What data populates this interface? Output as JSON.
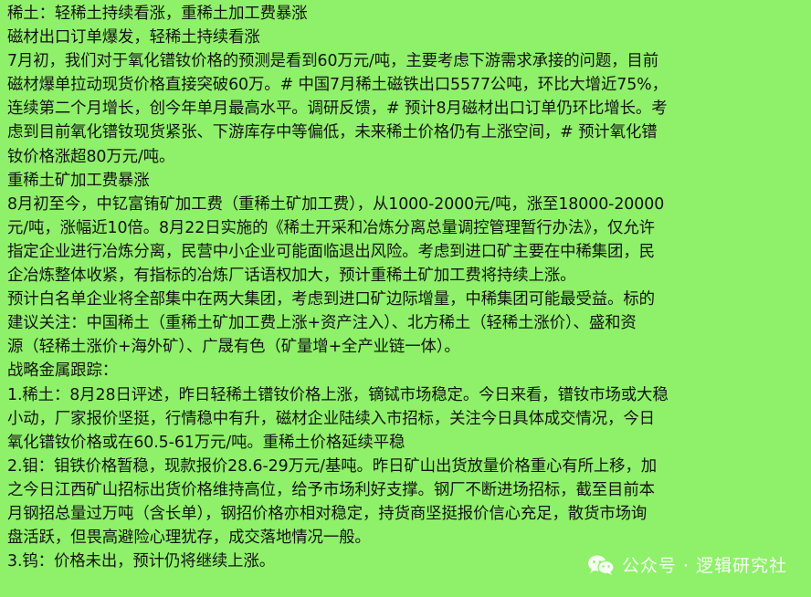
{
  "lines": [
    "稀土：轻稀土持续看涨，重稀土加工费暴涨",
    "磁材出口订单爆发，轻稀土持续看涨",
    "7月初，我们对于氧化镨钕价格的预测是看到60万元/吨，主要考虑下游需求承接的问题，目前",
    "磁材爆单拉动现货价格直接突破60万。# 中国7月稀土磁铁出口5577公吨，环比大增近75%，",
    "连续第二个月增长，创今年单月最高水平。调研反馈，# 预计8月磁材出口订单仍环比增长。考",
    "虑到目前氧化镨钕现货紧张、下游库存中等偏低，未来稀土价格仍有上涨空间，# 预计氧化镨",
    "钕价格涨超80万元/吨。",
    "重稀土矿加工费暴涨",
    "8月初至今，中钇富铕矿加工费（重稀土矿加工费），从1000-2000元/吨，涨至18000-20000",
    "元/吨，涨幅近10倍。8月22日实施的《稀土开采和冶炼分离总量调控管理暂行办法》，仅允许",
    "指定企业进行冶炼分离，民营中小企业可能面临退出风险。考虑到进口矿主要在中稀集团，民",
    "企冶炼整体收紧，有指标的冶炼厂话语权加大，预计重稀土矿加工费将持续上涨。",
    "预计白名单企业将全部集中在两大集团，考虑到进口矿边际增量，中稀集团可能最受益。标的",
    "建议关注：中国稀土（重稀土矿加工费上涨+资产注入）、北方稀土（轻稀土涨价）、盛和资",
    "源（轻稀土涨价+海外矿）、广晟有色（矿量增+全产业链一体）。",
    "战略金属跟踪：",
    "1.稀土：8月28日评述，昨日轻稀土镨钕价格上涨，镝铽市场稳定。今日来看，镨钕市场或大稳",
    "小动，厂家报价坚挺，行情稳中有升，磁材企业陆续入市招标，关注今日具体成交情况，今日",
    "氧化镨钕价格或在60.5-61万元/吨。重稀土价格延续平稳",
    "2.钼：钼铁价格暂稳，现款报价28.6-29万元/基吨。昨日矿山出货放量价格重心有所上移，加",
    "之今日江西矿山招标出货价格维持高位，给予市场利好支撑。钢厂不断进场招标，截至目前本",
    "月钢招总量过万吨（含长单），钢招价格亦相对稳定，持货商坚挺报价信心充足，散货市场询",
    "盘活跃，但畏高避险心理犹存，成交落地情况一般。",
    "3.钨：价格未出，预计仍将继续上涨。"
  ],
  "watermark": {
    "icon": "wechat-icon",
    "text": "公众号 · 逻辑研究社"
  },
  "colors": {
    "background": "#8ff06a",
    "text": "#141414",
    "watermark": "#ffffff"
  }
}
